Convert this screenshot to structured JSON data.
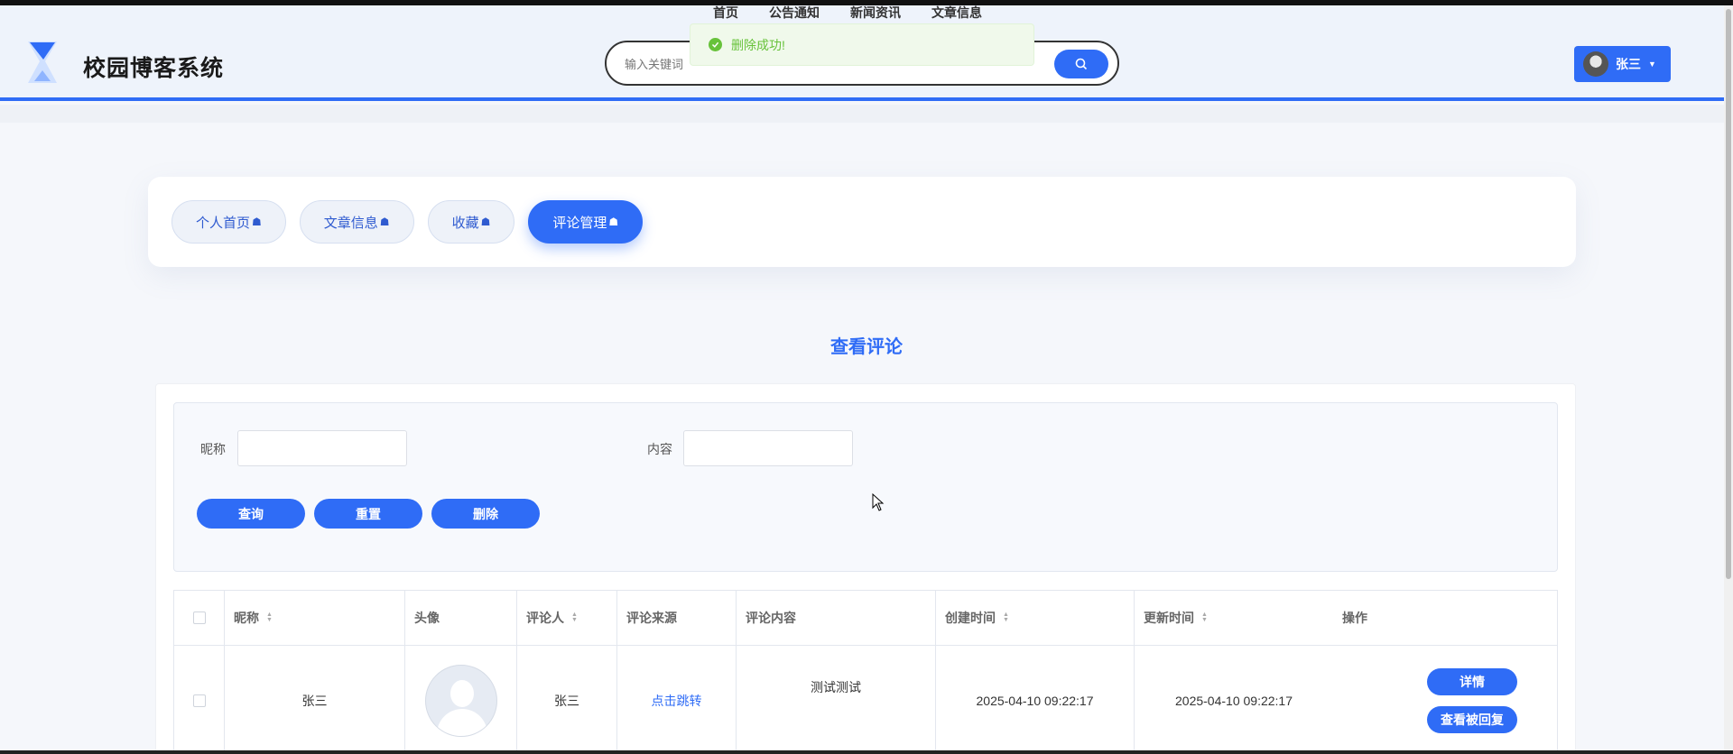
{
  "header": {
    "site_title": "校园博客系统",
    "nav": [
      "首页",
      "公告通知",
      "新闻资讯",
      "文章信息"
    ],
    "search_placeholder": "输入关键词",
    "user_name": "张三",
    "accent_color": "#2f6cf6"
  },
  "toast": {
    "message": "删除成功!",
    "type": "success"
  },
  "tabs": [
    {
      "label": "个人首页",
      "icon": "home-icon",
      "active": false
    },
    {
      "label": "文章信息",
      "icon": "home-icon",
      "active": false
    },
    {
      "label": "收藏",
      "icon": "home-icon",
      "active": false
    },
    {
      "label": "评论管理",
      "icon": "home-icon",
      "active": true
    }
  ],
  "page_title": "查看评论",
  "filters": {
    "nickname_label": "昵称",
    "content_label": "内容",
    "nickname_value": "",
    "content_value": "",
    "buttons": {
      "query": "查询",
      "reset": "重置",
      "delete": "删除"
    }
  },
  "table": {
    "headers": {
      "nickname": "昵称",
      "avatar": "头像",
      "commenter": "评论人",
      "source": "评论来源",
      "content": "评论内容",
      "created": "创建时间",
      "updated": "更新时间",
      "actions": "操作"
    },
    "rows": [
      {
        "nickname": "张三",
        "commenter": "张三",
        "source_link": "点击跳转",
        "content": "测试测试",
        "created": "2025-04-10 09:22:17",
        "updated": "2025-04-10 09:22:17",
        "detail_label": "详情",
        "view_replies_label": "查看被回复"
      }
    ]
  }
}
